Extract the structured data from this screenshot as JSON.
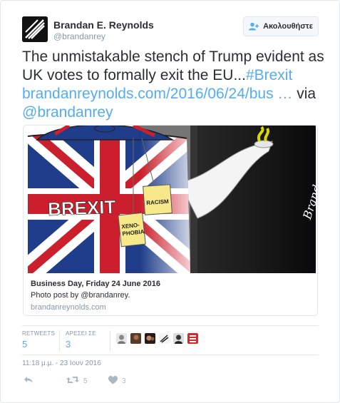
{
  "author": {
    "name": "Brandan E. Reynolds",
    "handle": "@brandanrey"
  },
  "follow_button": {
    "label": "Ακολουθήστε",
    "icon": "add-user-icon"
  },
  "tweet": {
    "text_part1": "The unmistakable stench of Trump evident as UK votes to formally exit the EU...",
    "hashtag": "#Brexit",
    "url": "brandanreynolds.com/2016/06/24/bus …",
    "via": " via ",
    "mention": "@brandanrey"
  },
  "card": {
    "image_text": {
      "brexit": "BREXIT",
      "tag1": "RACISM",
      "tag2_line1": "XENO-",
      "tag2_line2": "PHOBIA",
      "signature": "Brandan"
    },
    "title": "Business Day, Friday 24 June 2016",
    "description": "Photo post by @brandanrey.",
    "domain": "brandanreynolds.com"
  },
  "stats": {
    "retweets_label": "RETWEETS",
    "retweets_count": "5",
    "likes_label": "ΑΡΕΣΕΙ ΣΕ",
    "likes_count": "3"
  },
  "timestamp": "11:18 μ.μ. - 23 Ιουν 2016",
  "actions": {
    "reply_icon": "reply-icon",
    "retweet_icon": "retweet-icon",
    "retweet_count": "5",
    "like_icon": "heart-icon",
    "like_count": "3"
  },
  "colors": {
    "link": "#55acee",
    "meta": "#8899a6",
    "border": "#e1e8ed"
  }
}
